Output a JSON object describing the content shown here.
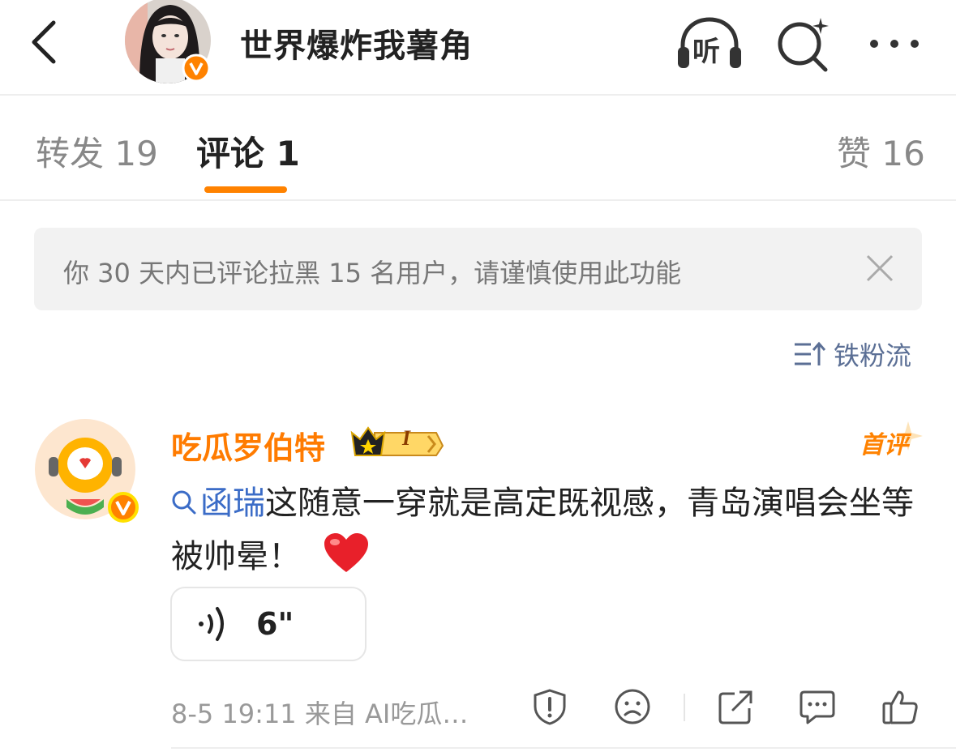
{
  "header": {
    "title": "世界爆炸我薯角",
    "listen_label": "听",
    "icons": [
      "back-icon",
      "listen-icon",
      "search-ai-icon",
      "more-icon"
    ]
  },
  "tabs": [
    {
      "label": "转发 19",
      "active": false
    },
    {
      "label": "评论 1",
      "active": true
    },
    {
      "label": "赞 16",
      "active": false
    }
  ],
  "notice": {
    "text": "你 30 天内已评论拉黑 15 名用户，请谨慎使用此功能"
  },
  "sort": {
    "label": "铁粉流"
  },
  "comment": {
    "author": "吃瓜罗伯特",
    "level_badge": "I",
    "first_tag": "首评",
    "keyword": "函瑞",
    "text": "这随意一穿就是高定既视感，青岛演唱会坐等被帅晕！",
    "emoji": "❤️",
    "voice_duration": "6\"",
    "meta": "8-5 19:11 来自 AI吃瓜…"
  },
  "colors": {
    "accent": "#ff8200",
    "author": "#ff7b00",
    "link": "#3b6cc7",
    "sort": "#5b6f95"
  }
}
